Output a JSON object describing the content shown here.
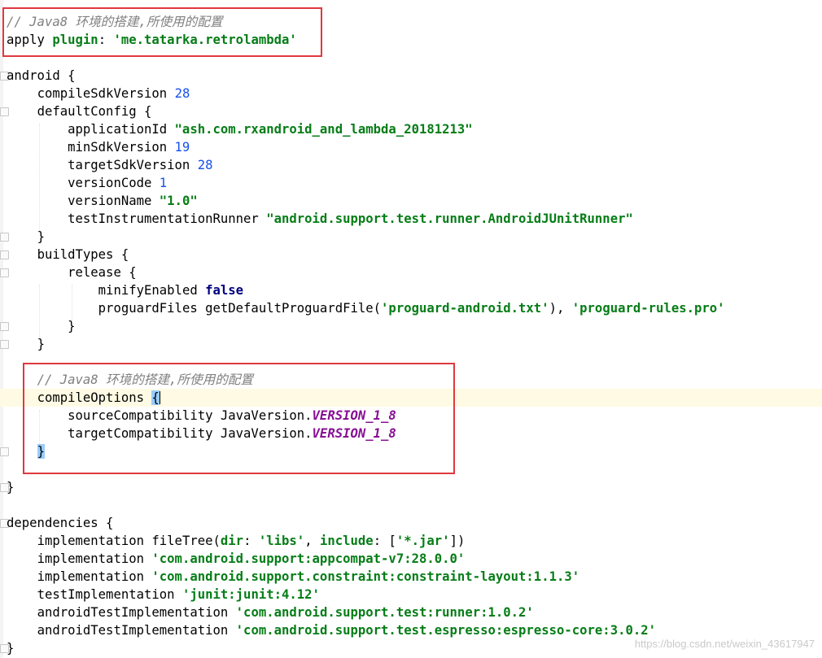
{
  "code": {
    "l1": {
      "comment": "// Java8 环境的搭建,所使用的配置"
    },
    "l2": {
      "apply": "apply",
      "plugin": "plugin",
      "colon": ": ",
      "value": "'me.tatarka.retrolambda'"
    },
    "l4": {
      "text": "android {"
    },
    "l5": {
      "key": "compileSdkVersion ",
      "num": "28"
    },
    "l6": {
      "text": "defaultConfig {"
    },
    "l7": {
      "key": "applicationId ",
      "str": "\"ash.com.rxandroid_and_lambda_20181213\""
    },
    "l8": {
      "key": "minSdkVersion ",
      "num": "19"
    },
    "l9": {
      "key": "targetSdkVersion ",
      "num": "28"
    },
    "l10": {
      "key": "versionCode ",
      "num": "1"
    },
    "l11": {
      "key": "versionName ",
      "str": "\"1.0\""
    },
    "l12": {
      "key": "testInstrumentationRunner ",
      "str": "\"android.support.test.runner.AndroidJUnitRunner\""
    },
    "l13": {
      "text": "}"
    },
    "l14": {
      "text": "buildTypes {"
    },
    "l15": {
      "text": "release {"
    },
    "l16": {
      "key": "minifyEnabled ",
      "kw": "false"
    },
    "l17": {
      "key": "proguardFiles getDefaultProguardFile(",
      "str1": "'proguard-android.txt'",
      "mid": "), ",
      "str2": "'proguard-rules.pro'"
    },
    "l18": {
      "text": "}"
    },
    "l19": {
      "text": "}"
    },
    "l21": {
      "comment": "// Java8 环境的搭建,所使用的配置"
    },
    "l22": {
      "key": "compileOptions ",
      "brace": "{"
    },
    "l23": {
      "key": "sourceCompatibility JavaVersion.",
      "cst": "VERSION_1_8"
    },
    "l24": {
      "key": "targetCompatibility JavaVersion.",
      "cst": "VERSION_1_8"
    },
    "l25": {
      "brace": "}"
    },
    "l27": {
      "text": "}"
    },
    "l29": {
      "text": "dependencies {"
    },
    "l30": {
      "a": "implementation fileTree(",
      "k1": "dir",
      "b": ": ",
      "s1": "'libs'",
      "c": ", ",
      "k2": "include",
      "d": ": [",
      "s2": "'*.jar'",
      "e": "])"
    },
    "l31": {
      "key": "implementation ",
      "str": "'com.android.support:appcompat-v7:28.0.0'"
    },
    "l32": {
      "key": "implementation ",
      "str": "'com.android.support.constraint:constraint-layout:1.1.3'"
    },
    "l33": {
      "key": "testImplementation ",
      "str": "'junit:junit:4.12'"
    },
    "l34": {
      "key": "androidTestImplementation ",
      "str": "'com.android.support.test:runner:1.0.2'"
    },
    "l35": {
      "key": "androidTestImplementation ",
      "str": "'com.android.support.test.espresso:espresso-core:3.0.2'"
    },
    "l36": {
      "text": "}"
    }
  },
  "watermark": "https://blog.csdn.net/weixin_43617947",
  "colors": {
    "comment": "#808080",
    "string": "#067d17",
    "number": "#1750eb",
    "keyword": "#000080",
    "constant": "#871094",
    "highlight_box": "#e0383e",
    "current_line": "#fffae3",
    "brace_match": "#99ccff"
  }
}
